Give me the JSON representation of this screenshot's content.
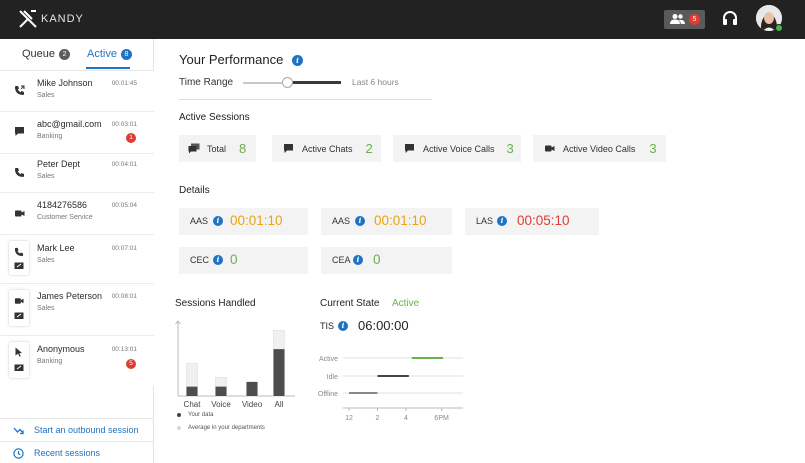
{
  "app": {
    "logo_text": "KANDY",
    "team_badge": "5"
  },
  "colors": {
    "accent": "#1f72c4",
    "green": "#6ab04c",
    "orange": "#e8a317",
    "red": "#e03c31"
  },
  "sidebar": {
    "tabs": [
      {
        "label": "Queue",
        "count": "2"
      },
      {
        "label": "Active",
        "count": "8"
      }
    ],
    "sessions": [
      {
        "name": "Mike Johnson",
        "dept": "Sales",
        "time": "00:01:45",
        "icon": "phone-transfer-icon",
        "badge": ""
      },
      {
        "name": "abc@gmail.com",
        "dept": "Banking",
        "time": "00:03:01",
        "icon": "chat-icon",
        "badge": "1"
      },
      {
        "name": "Peter Dept",
        "dept": "Sales",
        "time": "00:04:01",
        "icon": "phone-icon",
        "badge": ""
      },
      {
        "name": "4184276586",
        "dept": "Customer Service",
        "time": "00:05:04",
        "icon": "video-icon",
        "badge": ""
      },
      {
        "name": "Mark Lee",
        "dept": "Sales",
        "time": "00:07:01",
        "icon": "phone-screenshare-icon",
        "badge": ""
      },
      {
        "name": "James Peterson",
        "dept": "Sales",
        "time": "00:08:01",
        "icon": "video-screenshare-icon",
        "badge": ""
      },
      {
        "name": "Anonymous",
        "dept": "Banking",
        "time": "00:13:01",
        "icon": "cobrowse-icon",
        "badge": "5"
      }
    ],
    "bottom": {
      "outbound": "Start an outbound session",
      "recent": "Recent sessions"
    }
  },
  "performance": {
    "title": "Your Performance",
    "time_range_label": "Time Range",
    "time_range_value": "Last 6 hours",
    "time_range_slider_level": 0.45,
    "active_sessions_title": "Active Sessions",
    "active_sessions": [
      {
        "label": "Total",
        "value": "8",
        "icon": "chats-stack-icon"
      },
      {
        "label": "Active Chats",
        "value": "2",
        "icon": "chat-icon"
      },
      {
        "label": "Active Voice Calls",
        "value": "3",
        "icon": "voice-chat-icon"
      },
      {
        "label": "Active Video Calls",
        "value": "3",
        "icon": "video-icon"
      }
    ],
    "details_title": "Details",
    "details": [
      {
        "label": "AAS",
        "value": "00:01:10"
      },
      {
        "label": "AAS",
        "value": "00:01:10"
      },
      {
        "label": "LAS",
        "value": "00:05:10"
      },
      {
        "label": "CEC",
        "value": "0"
      },
      {
        "label": "CEA",
        "value": "0"
      }
    ],
    "sessions_handled_title": "Sessions Handled",
    "legend": {
      "yours": "Your data",
      "average": "Average in your departments"
    },
    "current_state_title": "Current State",
    "current_state_value": "Active",
    "tis_label": "TIS",
    "tis_value": "06:00:00"
  },
  "chart_data": [
    {
      "type": "bar",
      "categories": [
        "Chat",
        "Voice",
        "Video",
        "All"
      ],
      "series": [
        {
          "name": "Your data",
          "values": [
            2,
            2,
            3,
            10
          ]
        },
        {
          "name": "Average in your departments",
          "values": [
            7,
            4,
            3,
            14
          ]
        }
      ],
      "ylim": [
        0,
        16
      ],
      "legend": "bottom-left"
    },
    {
      "type": "line",
      "x_ticks": [
        "12",
        "2",
        "4",
        "6PM"
      ],
      "y_categories": [
        "Offline",
        "Idle",
        "Active"
      ],
      "segments": [
        {
          "state": "Offline",
          "from": 0,
          "to": 2
        },
        {
          "state": "Idle",
          "from": 2,
          "to": 4.2
        },
        {
          "state": "Active",
          "from": 4.4,
          "to": 6.6
        }
      ],
      "x_range": [
        0,
        8
      ],
      "grid": true
    }
  ]
}
